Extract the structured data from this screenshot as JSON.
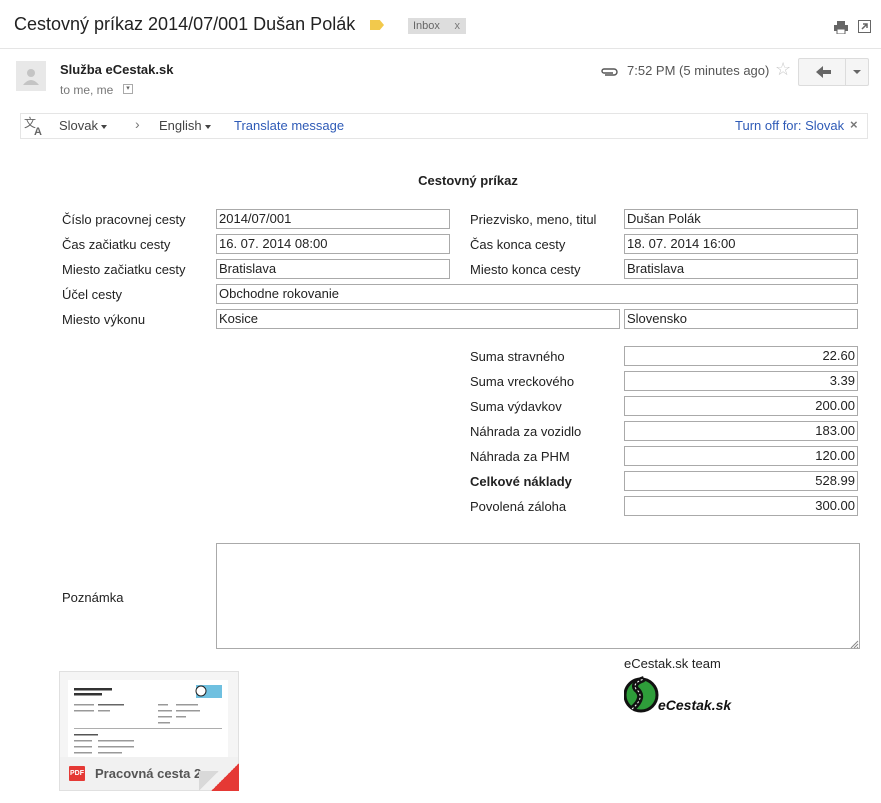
{
  "email": {
    "subject": "Cestovný príkaz 2014/07/001 Dušan Polák",
    "label": "Inbox",
    "label_close": "x",
    "sender": "Služba eCestak.sk",
    "recipients": "to me, me",
    "time": "7:52 PM (5 minutes ago)",
    "icons": [
      "label-icon",
      "print-icon",
      "new-window-icon",
      "attachment-clip-icon",
      "star-icon",
      "reply-icon",
      "more-caret-icon",
      "translate-icon",
      "close-icon"
    ]
  },
  "translate": {
    "from_lang": "Slovak",
    "arrow": "›",
    "to_lang": "English",
    "translate_link": "Translate message",
    "turn_off": "Turn off for: Slovak",
    "close": "×"
  },
  "doc": {
    "title": "Cestovný príkaz",
    "rows": [
      {
        "label": "Číslo pracovnej cesty",
        "value": "2014/07/001",
        "label2": "Priezvisko, meno, titul",
        "value2": "Dušan Polák"
      },
      {
        "label": "Čas začiatku cesty",
        "value": "16. 07. 2014 08:00",
        "label2": "Čas konca cesty",
        "value2": "18. 07. 2014 16:00"
      },
      {
        "label": "Miesto začiatku cesty",
        "value": "Bratislava",
        "label2": "Miesto konca cesty",
        "value2": "Bratislava"
      }
    ],
    "purpose_label": "Účel cesty",
    "purpose_value": "Obchodne rokovanie",
    "place_label": "Miesto výkonu",
    "place_city": "Kosice",
    "place_country": "Slovensko",
    "sums": [
      {
        "label": "Suma stravného",
        "value": "22.60"
      },
      {
        "label": "Suma vreckového",
        "value": "3.39"
      },
      {
        "label": "Suma výdavkov",
        "value": "200.00"
      },
      {
        "label": "Náhrada za vozidlo",
        "value": "183.00"
      },
      {
        "label": "Náhrada za PHM",
        "value": "120.00"
      },
      {
        "label": "Celkové náklady",
        "value": "528.99",
        "bold": true
      },
      {
        "label": "Povolená záloha",
        "value": "300.00"
      }
    ],
    "note_label": "Poznámka",
    "note_value": "",
    "team": "eCestak.sk team",
    "logo_text": "eCestak.sk"
  },
  "attachment": {
    "name": "Pracovná cesta 2...",
    "type": "PDF"
  },
  "colors": {
    "link": "#2f5bb7",
    "label_yellow": "#f2c94c",
    "pdf_red": "#e53935",
    "logo_green": "#2e9d3a"
  }
}
